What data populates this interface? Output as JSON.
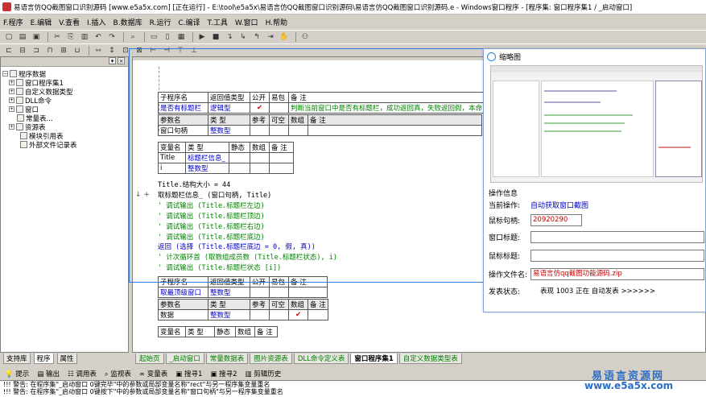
{
  "window": {
    "title": "易语言仿QQ截图窗口识别源码 [www.e5a5x.com] [正在运行] - E:\\tool\\e5a5x\\易语言仿QQ截图窗口识别源码\\易语言仿QQ截图窗口识别源码.e - Windows窗口程序 - [程序集: 窗口程序集1 / _启动窗口]"
  },
  "menu": [
    "F.程序",
    "E.编辑",
    "V.查看",
    "I.插入",
    "B.数据库",
    "R.运行",
    "C.编译",
    "T.工具",
    "W.窗口",
    "H.帮助"
  ],
  "left_panel": {
    "tree": [
      {
        "label": "程序数据",
        "level": 0,
        "icon": "folder-icon"
      },
      {
        "label": "窗口程序集1",
        "level": 1,
        "icon": "module-icon"
      },
      {
        "label": "自定义数据类型",
        "level": 1,
        "icon": "type-icon"
      },
      {
        "label": "DLL命令",
        "level": 1,
        "icon": "dll-icon"
      },
      {
        "label": "窗口",
        "level": 1,
        "icon": "window-icon"
      },
      {
        "label": "常量表...",
        "level": 1,
        "icon": "constant-icon"
      },
      {
        "label": "资源表",
        "level": 1,
        "icon": "resource-icon"
      },
      {
        "label": "模块引用表",
        "level": 2,
        "icon": "module-ref-icon"
      },
      {
        "label": "外部文件记录表",
        "level": 2,
        "icon": "external-file-icon"
      }
    ],
    "tabs": [
      "支持库",
      "程序",
      "属性"
    ]
  },
  "editor": {
    "sub1": {
      "header": [
        "子程序名",
        "返回值类型",
        "公开",
        "易包",
        "备 注"
      ],
      "row": [
        "是否有标题栏",
        "逻辑型",
        "✔",
        "",
        "判断当前窗口中是否有标题栏，成功返回真，失败返回假，本命"
      ],
      "param_header": [
        "参数名",
        "类 型",
        "参考",
        "可空",
        "数组",
        "备 注"
      ],
      "param_row": [
        "窗口句柄",
        "整数型",
        "",
        "",
        "",
        ""
      ],
      "var_header": [
        "变量名",
        "类 型",
        "静态",
        "数组",
        "备 注"
      ],
      "var_rows": [
        [
          "Title",
          "标题栏信息_",
          "",
          "",
          ""
        ],
        [
          "i",
          "整数型",
          "",
          "",
          ""
        ]
      ]
    },
    "code": [
      {
        "text": "Title.结构大小 = 44",
        "cls": ""
      },
      {
        "text": "取标题栏信息_ (窗口句柄, Title)",
        "cls": ""
      },
      {
        "text": "' 调试输出 (Title.标题栏左边)",
        "cls": "green"
      },
      {
        "text": "' 调试输出 (Title.标题栏顶边)",
        "cls": "green"
      },
      {
        "text": "' 调试输出 (Title.标题栏右边)",
        "cls": "green"
      },
      {
        "text": "' 调试输出 (Title.标题栏底边)",
        "cls": "green"
      },
      {
        "text": "返回 (选择 (Title.标题栏底边 = 0, 假, 真))",
        "cls": "blue"
      },
      {
        "text": "' 计次循环首 (取数组成员数 (Title.标题栏状态), i)",
        "cls": "green"
      },
      {
        "text": "' 调试输出 (Title.标题栏状态 [i])",
        "cls": "green"
      }
    ],
    "gutter": "↓ +",
    "sub2": {
      "header": [
        "子程序名",
        "返回值类型",
        "公开",
        "易包",
        "备 注"
      ],
      "row": [
        "取最顶级窗口",
        "整数型",
        "",
        "",
        ""
      ],
      "param_header": [
        "参数名",
        "类 型",
        "参考",
        "可空",
        "数组",
        "备 注"
      ],
      "param_row": [
        "数据",
        "整数型",
        "",
        "",
        "✔",
        ""
      ],
      "var_header": [
        "变量名",
        "类 型",
        "静态",
        "数组",
        "备 注"
      ]
    },
    "tabs": [
      "起始页",
      "_启动窗口",
      "常量数据表",
      "图片资源表",
      "DLL命令定义表",
      "窗口程序集1",
      "自定义数据类型表"
    ],
    "active_tab": "窗口程序集1"
  },
  "preview": {
    "title": "缩略图",
    "section": "操作信息",
    "rows": [
      {
        "label": "当前操作:",
        "value": "自动获取窗口截图",
        "boxed": false,
        "color": "#0000c8"
      },
      {
        "label": "鼠标句柄:",
        "value": "20920290",
        "boxed": true,
        "color": "#c80000"
      },
      {
        "label": "窗口标题:",
        "value": "",
        "boxed": true,
        "color": "#000"
      },
      {
        "label": "鼠标标题:",
        "value": "",
        "boxed": true,
        "color": "#000"
      },
      {
        "label": "操作文件名:",
        "value": "易语言仿qq截图功能源码.zip",
        "boxed": true,
        "color": "#c80000"
      }
    ],
    "status_label": "发表状态:",
    "status_value": "表现 1003 正在 自动发表 >>>>>>"
  },
  "bottom_tabs": [
    "提示",
    "输出",
    "调用表",
    "监视表",
    "变量表",
    "搜寻1",
    "搜寻2",
    "剪辑历史"
  ],
  "output_lines": [
    "!!! 警告: 在程序集\"_启动窗口 0键完毕\"中的参数或局部变量名称\"rect\"与另一程序集变量重名",
    "!!! 警告: 在程序集\"_启动窗口 0键按下\"中的参数或局部变量名称\"窗口句柄\"与另一程序集变量重名"
  ],
  "watermark": {
    "line1": "易语言资源网",
    "line2": "www.e5a5x.com"
  },
  "colors": {
    "accent": "#2a7ae2",
    "keyword_blue": "#0000c8",
    "comment_green": "#008000",
    "error_red": "#c80000"
  }
}
